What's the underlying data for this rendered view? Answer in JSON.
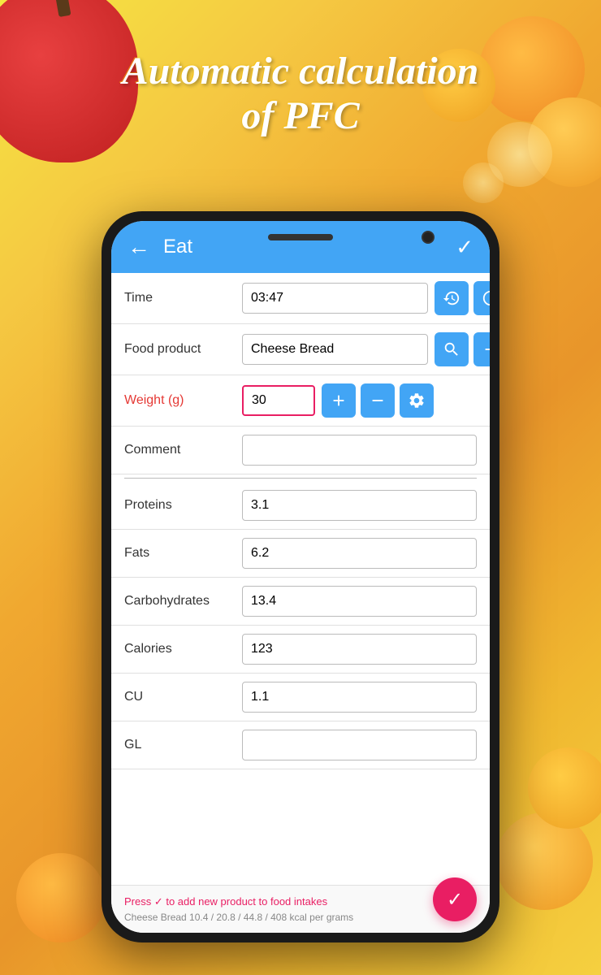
{
  "background": {
    "headline_line1": "Automatic calculation",
    "headline_line2": "of PFC"
  },
  "app": {
    "top_bar": {
      "back_icon": "←",
      "title": "Eat",
      "check_icon": "✓"
    },
    "form": {
      "rows": [
        {
          "label": "Time",
          "value": "03:47",
          "type": "time",
          "buttons": [
            "clock-history",
            "clock-current"
          ]
        },
        {
          "label": "Food product",
          "value": "Cheese Bread",
          "type": "text",
          "buttons": [
            "search",
            "add"
          ]
        },
        {
          "label": "Weight (g)",
          "value": "30",
          "type": "number",
          "highlight": true,
          "label_red": true,
          "buttons": [
            "plus",
            "minus",
            "gear"
          ]
        },
        {
          "label": "Comment",
          "value": "",
          "type": "text",
          "buttons": []
        }
      ],
      "nutrition_rows": [
        {
          "label": "Proteins",
          "value": "3.1"
        },
        {
          "label": "Fats",
          "value": "6.2"
        },
        {
          "label": "Carbohydrates",
          "value": "13.4"
        },
        {
          "label": "Calories",
          "value": "123"
        },
        {
          "label": "CU",
          "value": "1.1"
        },
        {
          "label": "GL",
          "value": ""
        }
      ]
    },
    "bottom_bar": {
      "info_text": "Press ✓ to add new product to food intakes",
      "sub_text": "Cheese Bread  10.4 / 20.8 / 44.8 / 408 kcal per grams",
      "fab_icon": "✓"
    }
  }
}
